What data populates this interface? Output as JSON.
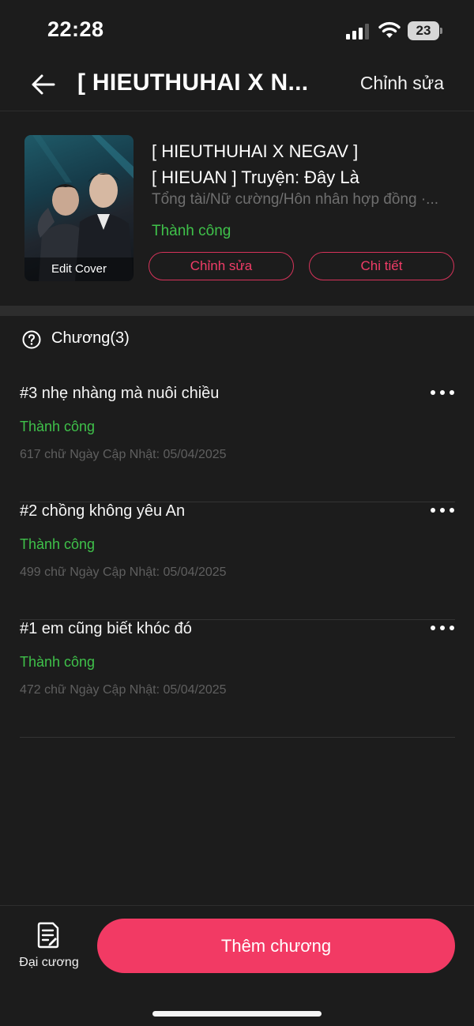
{
  "status_bar": {
    "time": "22:28",
    "battery": "23"
  },
  "nav": {
    "title": "[ HIEUTHUHAI X N...",
    "edit_label": "Chỉnh sửa",
    "icons": {
      "back": "arrow-left-icon"
    }
  },
  "story": {
    "cover_label": "Edit Cover",
    "title_line1": "[ HIEUTHUHAI X NEGAV ]",
    "title_line2": "[ HIEUAN ] Truyện: Đây Là",
    "genres": "Tổng tài/Nữ cường/Hôn nhân hợp đồng ·...",
    "status": "Thành công",
    "edit_button": "Chỉnh sửa",
    "detail_button": "Chi tiết"
  },
  "chapters_section": {
    "label": "Chương(3)",
    "icon": "help-circle-icon"
  },
  "chapters": [
    {
      "title": "#3 nhẹ nhàng mà nuôi chiều",
      "status": "Thành công",
      "meta": "617 chữ Ngày Cập Nhật: 05/04/2025"
    },
    {
      "title": "#2 chồng không yêu An",
      "status": "Thành công",
      "meta": "499 chữ Ngày Cập Nhật: 05/04/2025"
    },
    {
      "title": "#1 em cũng biết khóc đó",
      "status": "Thành công",
      "meta": "472 chữ Ngày Cập Nhật: 05/04/2025"
    }
  ],
  "bottom_bar": {
    "outline_label": "Đại cương",
    "add_chapter_label": "Thêm chương"
  },
  "colors": {
    "background": "#1c1c1c",
    "accent": "#f23a64",
    "success": "#3fc14a",
    "muted": "#6f6f6f"
  }
}
